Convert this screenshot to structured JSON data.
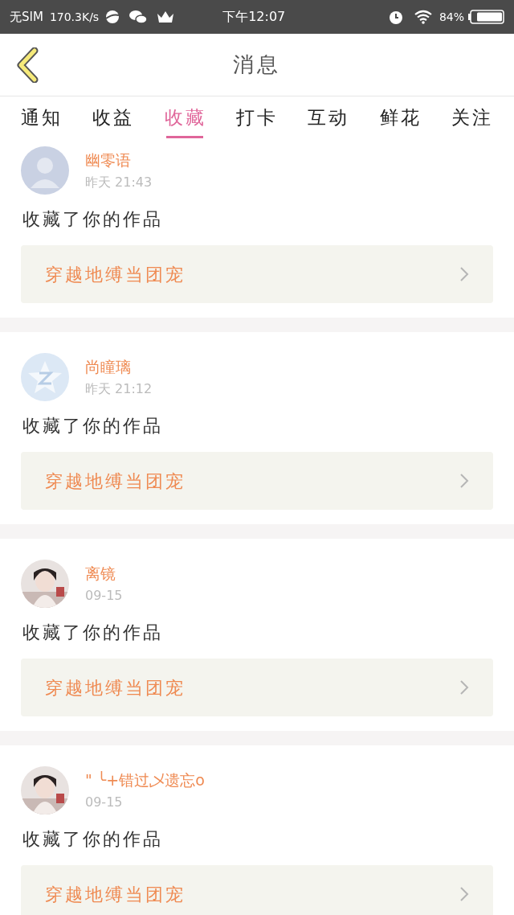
{
  "status_bar": {
    "carrier": "无SIM",
    "speed": "170.3K/s",
    "time": "下午12:07",
    "battery": "84%"
  },
  "header": {
    "title": "消息"
  },
  "tabs": [
    {
      "label": "通知",
      "selected": false
    },
    {
      "label": "收益",
      "selected": false
    },
    {
      "label": "收藏",
      "selected": true
    },
    {
      "label": "打卡",
      "selected": false
    },
    {
      "label": "互动",
      "selected": false
    },
    {
      "label": "鲜花",
      "selected": false
    },
    {
      "label": "关注",
      "selected": false
    }
  ],
  "messages": [
    {
      "avatar": {
        "kind": "default"
      },
      "name": "幽零语",
      "time": "昨天 21:43",
      "text": "收藏了你的作品",
      "work": "穿越地缚当团宠"
    },
    {
      "avatar": {
        "kind": "star"
      },
      "name": "尚瞳璃",
      "time": "昨天 21:12",
      "text": "收藏了你的作品",
      "work": "穿越地缚当团宠"
    },
    {
      "name": "离镜",
      "time": "09-15",
      "text": "收藏了你的作品",
      "work": "穿越地缚当团宠"
    },
    {
      "name": "\" ╰+错过乄遗忘o",
      "time": "09-15",
      "text": "收藏了你的作品",
      "work": "穿越地缚当团宠"
    }
  ]
}
